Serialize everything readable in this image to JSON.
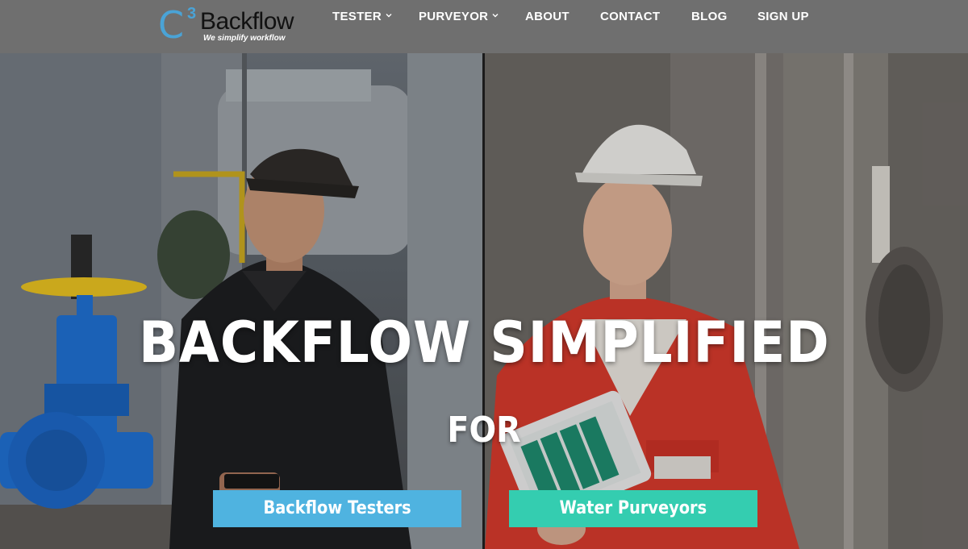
{
  "brand": {
    "logo_letter": "C",
    "logo_superscript": "3",
    "logo_wordmark": "Backflow",
    "tagline": "We simplify workflow",
    "accent_color": "#4aa3d6"
  },
  "nav": {
    "items": [
      {
        "label": "TESTER",
        "has_dropdown": true
      },
      {
        "label": "PURVEYOR",
        "has_dropdown": true
      },
      {
        "label": "ABOUT",
        "has_dropdown": false
      },
      {
        "label": "CONTACT",
        "has_dropdown": false
      },
      {
        "label": "BLOG",
        "has_dropdown": false
      },
      {
        "label": "SIGN UP",
        "has_dropdown": false
      }
    ]
  },
  "hero": {
    "headline": "BACKFLOW SIMPLIFIED",
    "subheadline": "FOR",
    "buttons": {
      "testers": {
        "label": "Backflow Testers",
        "color": "#4fb3e0"
      },
      "purveyors": {
        "label": "Water Purveyors",
        "color": "#34cdb0"
      }
    },
    "images": {
      "left": "tester-man-with-phone-at-valve-site",
      "right": "purveyor-woman-with-tablet-in-plant"
    }
  },
  "colors": {
    "header_bg": "#6f6f6f",
    "valve_blue": "#1f6fd0",
    "valve_yellow": "#e6c020",
    "coverall_red": "#d43a2c"
  }
}
